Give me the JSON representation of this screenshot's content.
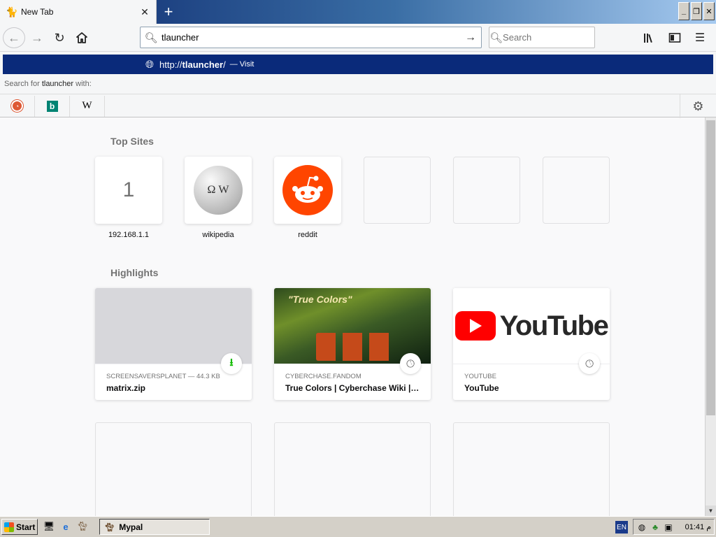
{
  "browser": {
    "tab": {
      "title": "New Tab",
      "icon": "ninja-cat-icon",
      "close": "close-icon"
    },
    "new_tab_symbol": "+",
    "window_controls": [
      "minimize",
      "restore",
      "close"
    ]
  },
  "navbar": {
    "url_value": "tlauncher",
    "search_placeholder": "Search"
  },
  "autocomplete": {
    "url_prefix": "http://",
    "url_bold": "tlauncher",
    "url_suffix": "/",
    "visit_separator": "—",
    "visit_label": "Visit",
    "search_for_prefix": "Search for",
    "search_for_term": "tlauncher",
    "search_for_suffix": "with:",
    "engines": [
      "duckduckgo",
      "bing",
      "wikipedia"
    ],
    "wiki_glyph": "W",
    "bing_glyph": "b"
  },
  "top_sites": {
    "title": "Top Sites",
    "items": [
      {
        "label": "192.168.1.1",
        "letter": "1"
      },
      {
        "label": "wikipedia"
      },
      {
        "label": "reddit"
      },
      {
        "label": ""
      },
      {
        "label": ""
      },
      {
        "label": ""
      }
    ]
  },
  "highlights": {
    "title": "Highlights",
    "cards": [
      {
        "meta": "SCREENSAVERSPLANET — 44.3 KB",
        "title": "matrix.zip",
        "badge": "download-icon"
      },
      {
        "meta": "CYBERCHASE.FANDOM",
        "title": "True Colors | Cyberchase Wiki | ...",
        "badge": "clock-icon",
        "thumb_text": "\"True Colors\""
      },
      {
        "meta": "YOUTUBE",
        "title": "YouTube",
        "badge": "clock-icon",
        "logo_text": "YouTube"
      }
    ]
  },
  "taskbar": {
    "start_label": "Start",
    "task_label": "Mypal",
    "lang": "EN",
    "clock": "01:41 م"
  }
}
